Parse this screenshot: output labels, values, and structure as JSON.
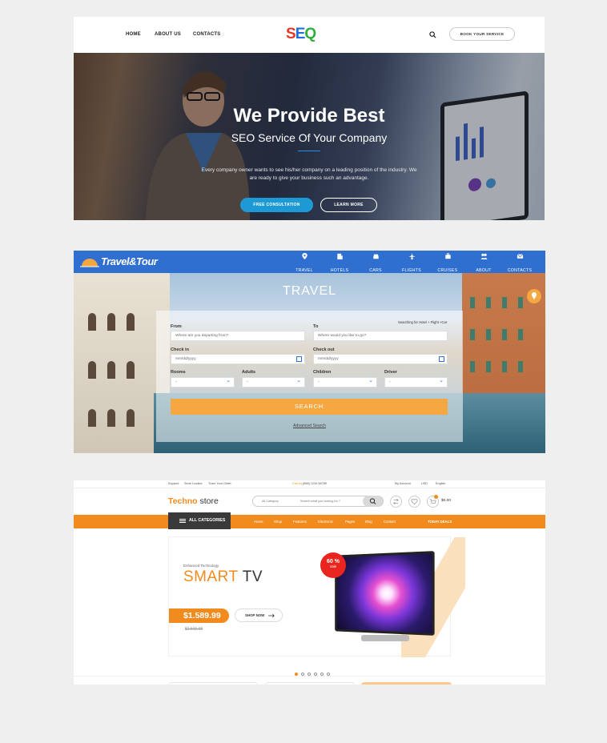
{
  "seo": {
    "nav": {
      "home": "HOME",
      "about": "ABOUT US",
      "contacts": "CONTACTS"
    },
    "logo": {
      "s": "S",
      "e": "E",
      "q": "Q"
    },
    "book_button": "BOOK YOUR SERVICE",
    "hero": {
      "title": "We Provide Best",
      "subtitle": "SEO Service Of Your Company",
      "description": "Every company owner wants to see his/her company on a leading position of the industry. We are ready to give your business such an advantage.",
      "primary_button": "FREE CONSULTATION",
      "secondary_button": "LEARN MORE"
    },
    "colors": {
      "accent": "#1d9ad6",
      "logo_s": "#e8352b",
      "logo_e": "#1f6fd6",
      "logo_q": "#2fae3e"
    }
  },
  "travel": {
    "brand": "Travel&Tour",
    "nav": [
      {
        "label": "TRAVEL",
        "icon": "map-pin-icon",
        "active": true
      },
      {
        "label": "HOTELS",
        "icon": "building-icon",
        "active": false
      },
      {
        "label": "CARS",
        "icon": "car-icon",
        "active": false
      },
      {
        "label": "FLIGHTS",
        "icon": "plane-icon",
        "active": false
      },
      {
        "label": "CRUISES",
        "icon": "suitcase-icon",
        "active": false
      },
      {
        "label": "ABOUT",
        "icon": "people-icon",
        "active": false
      },
      {
        "label": "CONTACTS",
        "icon": "envelope-icon",
        "active": false
      }
    ],
    "heading": "TRAVEL",
    "form": {
      "note": "Searching for Hotel + Flight +Car",
      "from_label": "From",
      "from_placeholder": "Where are you departing from?",
      "to_label": "To",
      "to_placeholder": "Where would you like to go?",
      "checkin_label": "Check in",
      "checkin_placeholder": "mm/dd/yyyy",
      "checkout_label": "Check out",
      "checkout_placeholder": "mm/dd/yyyy",
      "rooms_label": "Rooms",
      "rooms_value": "-",
      "adults_label": "Adults",
      "adults_value": "-",
      "children_label": "Children",
      "children_value": "-",
      "driver_label": "Driver",
      "driver_value": "-",
      "search_button": "SEARCH",
      "advanced_link": "Advanced Search"
    },
    "colors": {
      "nav": "#2f6fd0",
      "accent": "#f5a742"
    }
  },
  "techno": {
    "topbar": {
      "support": "Support",
      "store_locator": "Store Locator",
      "track_order": "Track Your Order",
      "call_label": "Call Us",
      "phone": "(888) 1234 56789",
      "account": "My Account",
      "currency": "USD",
      "language": "English"
    },
    "logo": {
      "brand": "Techno",
      "rest": " store"
    },
    "search": {
      "category": "All Category",
      "placeholder": "Search what you looking for ?"
    },
    "cart_total": "$0.00",
    "all_categories": "ALL CATEGORIES",
    "menu": [
      "Home",
      "Shop",
      "Features",
      "Electronic",
      "Pages",
      "Blog",
      "Contact"
    ],
    "today_deals": "TODAY DEALS",
    "banner": {
      "eyebrow": "Enhanced Technology",
      "title_accent": "SMART",
      "title_rest": " TV",
      "price": "$1.589.99",
      "old_price": "$2.500.99",
      "shop_now": "SHOP NOW",
      "badge_percent": "60 %",
      "badge_label": "sale"
    },
    "slider_dots": 6,
    "colors": {
      "accent": "#f28b1e",
      "dark": "#3a3a3a",
      "badge": "#e8261f"
    }
  }
}
